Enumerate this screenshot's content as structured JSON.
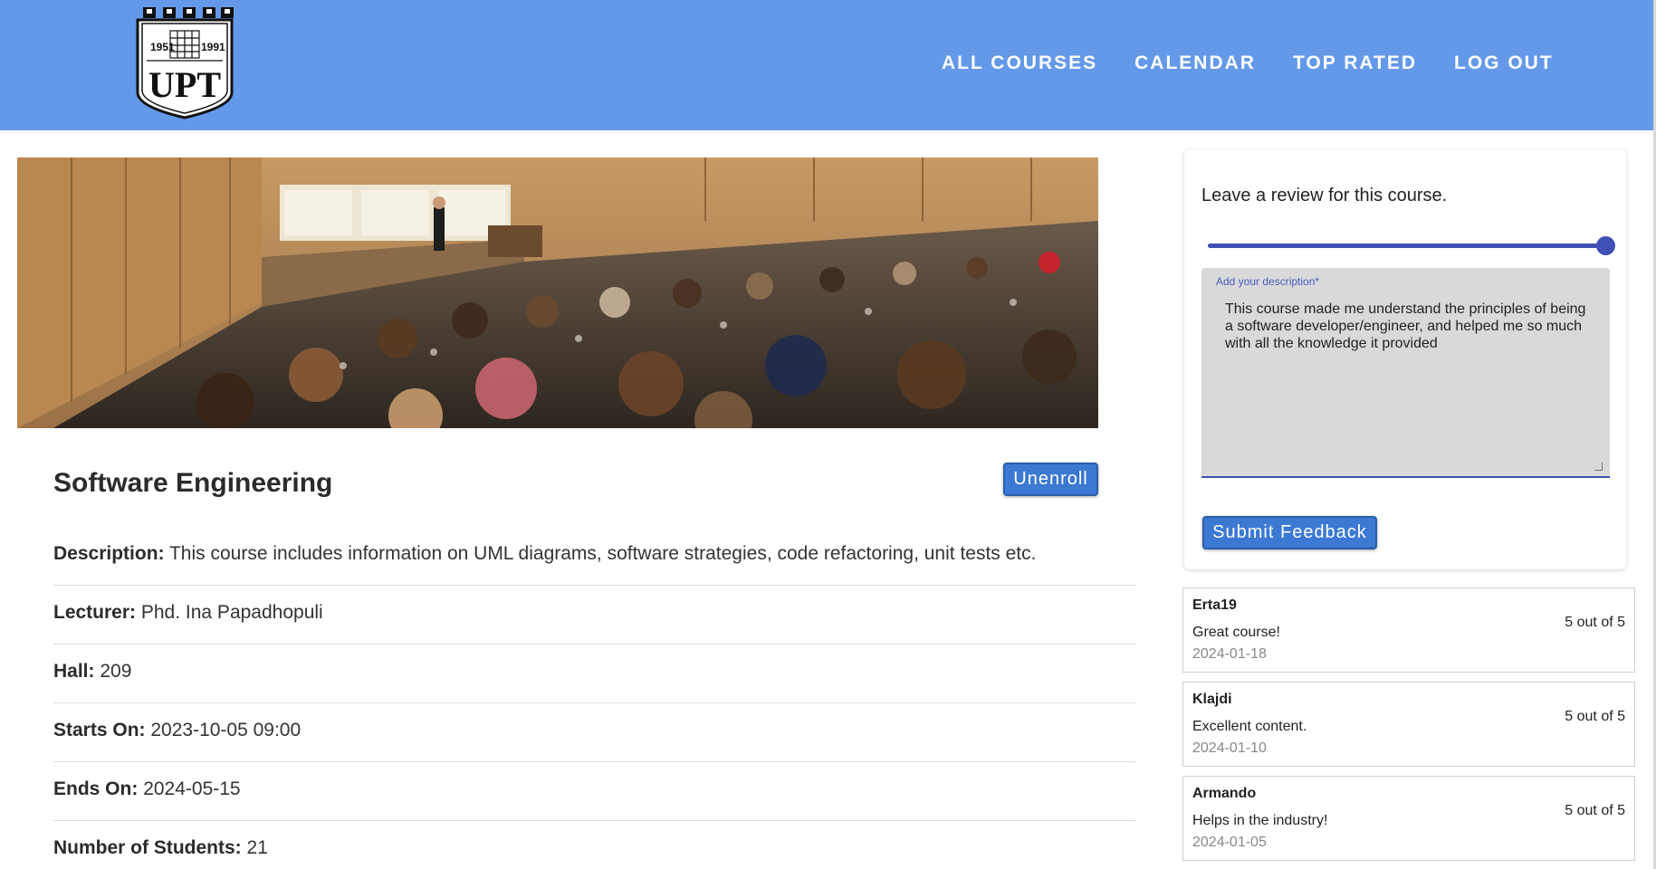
{
  "header": {
    "logo": {
      "years_left": "1951",
      "years_right": "1991",
      "text": "UPT"
    },
    "nav": [
      "ALL COURSES",
      "CALENDAR",
      "TOP RATED",
      "LOG OUT"
    ],
    "colors": {
      "bar": "#6499e9",
      "button": "#3b79d3",
      "accent": "#3f51b5"
    }
  },
  "course": {
    "title": "Software Engineering",
    "unenroll_label": "Unenroll",
    "fields": [
      {
        "label": "Description:",
        "value": "This course includes information on UML diagrams, software strategies, code refactoring, unit tests etc."
      },
      {
        "label": "Lecturer:",
        "value": "Phd. Ina Papadhopuli"
      },
      {
        "label": "Hall:",
        "value": "209"
      },
      {
        "label": "Starts On:",
        "value": "2023-10-05 09:00"
      },
      {
        "label": "Ends On:",
        "value": "2024-05-15"
      },
      {
        "label": "Number of Students:",
        "value": "21"
      }
    ]
  },
  "review_form": {
    "prompt": "Leave a review for this course.",
    "rating_level": 1.0,
    "description_label": "Add your description*",
    "description_value": "This course made me understand the principles of being a software developer/engineer, and helped me so much with all the knowledge it provided",
    "submit_label": "Submit Feedback"
  },
  "reviews": [
    {
      "user": "Erta19",
      "comment": "Great course!",
      "date": "2024-01-18",
      "rating": "5 out of 5"
    },
    {
      "user": "Klajdi",
      "comment": "Excellent content.",
      "date": "2024-01-10",
      "rating": "5 out of 5"
    },
    {
      "user": "Armando",
      "comment": "Helps in the industry!",
      "date": "2024-01-05",
      "rating": "5 out of 5"
    }
  ]
}
